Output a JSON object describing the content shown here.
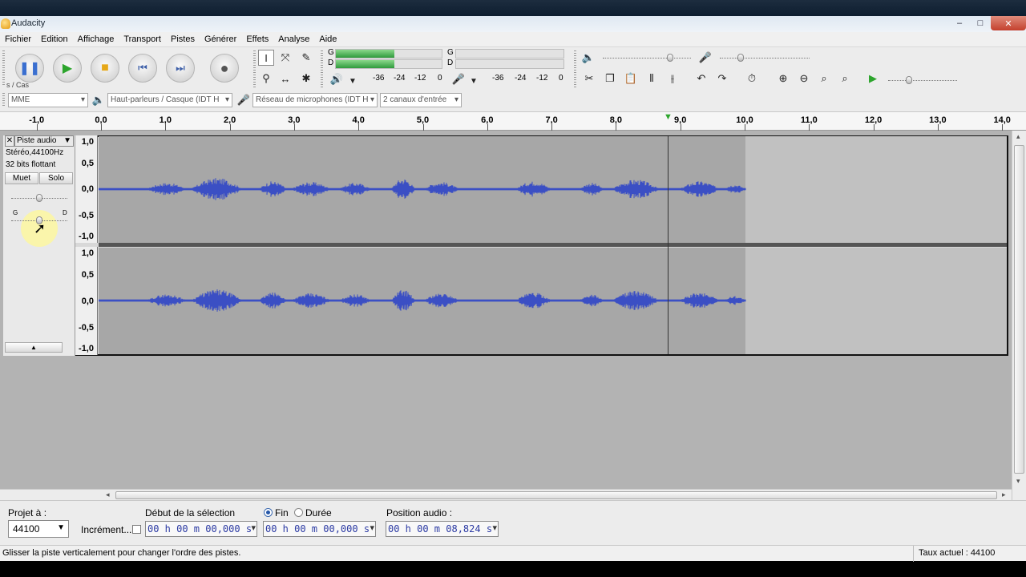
{
  "window": {
    "title": "Audacity",
    "min": "–",
    "max": "□",
    "close": "✕"
  },
  "menu": [
    "Fichier",
    "Edition",
    "Affichage",
    "Transport",
    "Pistes",
    "Générer",
    "Effets",
    "Analyse",
    "Aide"
  ],
  "toolbar": {
    "grip_label": "s / Cas",
    "meter_rec_left": "G",
    "meter_rec_right": "D",
    "meter_play_left": "G",
    "meter_play_right": "D",
    "meter_ticks_rec": [
      "-36",
      "-24",
      "-12",
      "0"
    ],
    "meter_ticks_play": [
      "-36",
      "-24",
      "-12",
      "0"
    ],
    "rec_level": 0.55,
    "play_level": 0.0
  },
  "devices": {
    "host": "MME",
    "output": "Haut-parleurs / Casque (IDT H",
    "input": "Réseau de microphones (IDT H",
    "channels": "2 canaux d'entrée"
  },
  "ruler": {
    "ticks": [
      "-1,0",
      "0,0",
      "1,0",
      "2,0",
      "3,0",
      "4,0",
      "5,0",
      "6,0",
      "7,0",
      "8,0",
      "9,0",
      "10,0",
      "11,0",
      "12,0",
      "13,0",
      "14,0"
    ]
  },
  "track": {
    "name": "Piste audio",
    "format": "Stéréo,44100Hz",
    "bits": "32 bits flottant",
    "mute": "Muet",
    "solo": "Solo",
    "pan_left": "G",
    "pan_right": "D",
    "scale": [
      "1,0",
      "0,5",
      "0,0",
      "-0,5",
      "-1,0"
    ]
  },
  "bottom": {
    "project_rate_label": "Projet à :",
    "project_rate_value": "44100",
    "snap_label": "Incrément...",
    "sel_start_label": "Début de la sélection",
    "end_label": "Fin",
    "length_label": "Durée",
    "audio_pos_label": "Position audio :",
    "sel_start": "00 h 00 m 00,000 s",
    "sel_end": "00 h 00 m 00,000 s",
    "audio_pos": "00 h 00 m 08,824 s"
  },
  "status": {
    "message": "Glisser la piste verticalement pour changer l'ordre des pistes.",
    "rate": "Taux actuel : 44100"
  }
}
